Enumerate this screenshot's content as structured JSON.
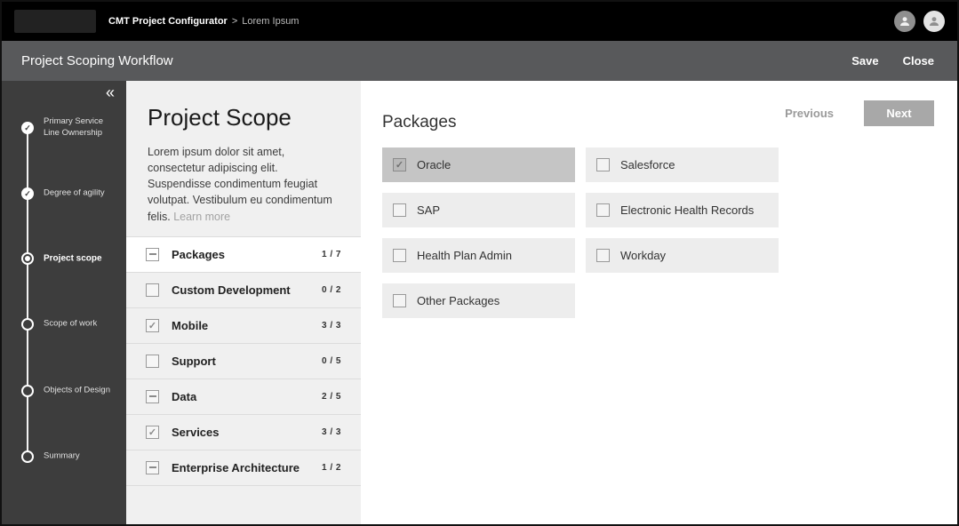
{
  "topbar": {
    "breadcrumb": {
      "app": "CMT Project Configurator",
      "separator": ">",
      "page": "Lorem Ipsum"
    }
  },
  "header": {
    "title": "Project Scoping Workflow",
    "save_label": "Save",
    "close_label": "Close"
  },
  "sidebar": {
    "collapse_icon": "«",
    "steps": [
      {
        "label": "Primary Service Line Ownership",
        "state": "complete"
      },
      {
        "label": "Degree of agility",
        "state": "complete"
      },
      {
        "label": "Project scope",
        "state": "current"
      },
      {
        "label": "Scope of work",
        "state": "pending"
      },
      {
        "label": "Objects of Design",
        "state": "pending"
      },
      {
        "label": "Summary",
        "state": "pending"
      }
    ]
  },
  "scope_panel": {
    "title": "Project Scope",
    "description": "Lorem ipsum dolor sit amet, consectetur adipiscing elit. Suspendisse condimentum feugiat volutpat. Vestibulum eu condimentum felis.",
    "learn_more_label": "Learn more",
    "categories": [
      {
        "label": "Packages",
        "count": "1 / 7",
        "checkbox": "indeterminate",
        "selected": true
      },
      {
        "label": "Custom Development",
        "count": "0 / 2",
        "checkbox": "unchecked",
        "selected": false
      },
      {
        "label": "Mobile",
        "count": "3 / 3",
        "checkbox": "checked",
        "selected": false
      },
      {
        "label": "Support",
        "count": "0 / 5",
        "checkbox": "unchecked",
        "selected": false
      },
      {
        "label": "Data",
        "count": "2 / 5",
        "checkbox": "indeterminate",
        "selected": false
      },
      {
        "label": "Services",
        "count": "3 / 3",
        "checkbox": "checked",
        "selected": false
      },
      {
        "label": "Enterprise Architecture",
        "count": "1 / 2",
        "checkbox": "indeterminate",
        "selected": false
      }
    ]
  },
  "main": {
    "title": "Packages",
    "previous_label": "Previous",
    "next_label": "Next",
    "options": [
      {
        "label": "Oracle",
        "checked": true
      },
      {
        "label": "Salesforce",
        "checked": false
      },
      {
        "label": "SAP",
        "checked": false
      },
      {
        "label": "Electronic Health Records",
        "checked": false
      },
      {
        "label": "Health Plan Admin",
        "checked": false
      },
      {
        "label": "Workday",
        "checked": false
      },
      {
        "label": "Other Packages",
        "checked": false
      }
    ]
  },
  "colors": {
    "topbar": "#000000",
    "header": "#58595b",
    "sidebar": "#3d3d3d",
    "panel_bg": "#f0f0f0",
    "card_bg": "#ededed",
    "selected_card": "#c5c5c5",
    "next_button": "#a8a8a8"
  }
}
